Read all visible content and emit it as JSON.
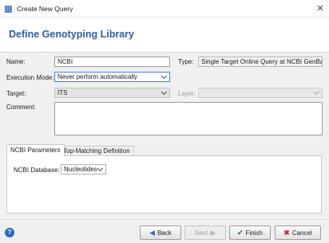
{
  "window": {
    "title": "Create New Query",
    "close_glyph": "✕",
    "app_icon": "dots-grid-icon"
  },
  "banner": {
    "title": "Define Genotyping Library"
  },
  "form": {
    "name_label": "Name:",
    "name_value": "NCBI",
    "type_label": "Type:",
    "type_value": "Single Target Online Query at NCBI GenBank",
    "execution_label": "Execution Mode:",
    "execution_value": "Never perform automatically",
    "target_label": "Target:",
    "target_value": "ITS",
    "layer_label": "Layer:",
    "layer_value": "",
    "comment_label": "Comment:",
    "comment_value": ""
  },
  "tabs": [
    {
      "label": "NCBI Parameters",
      "active": true
    },
    {
      "label": "Top-Matching Definition",
      "active": false
    }
  ],
  "ncbi_params": {
    "database_label": "NCBI Database:",
    "database_value": "Nucleotides"
  },
  "footer": {
    "help_glyph": "?",
    "back_label": "Back",
    "next_label": "Next",
    "finish_label": "Finish",
    "cancel_label": "Cancel"
  },
  "colors": {
    "accent": "#2a5fa8",
    "focus_border": "#3c7fd8",
    "finish_icon": "#2f9a2a",
    "cancel_icon": "#d42a2a"
  }
}
